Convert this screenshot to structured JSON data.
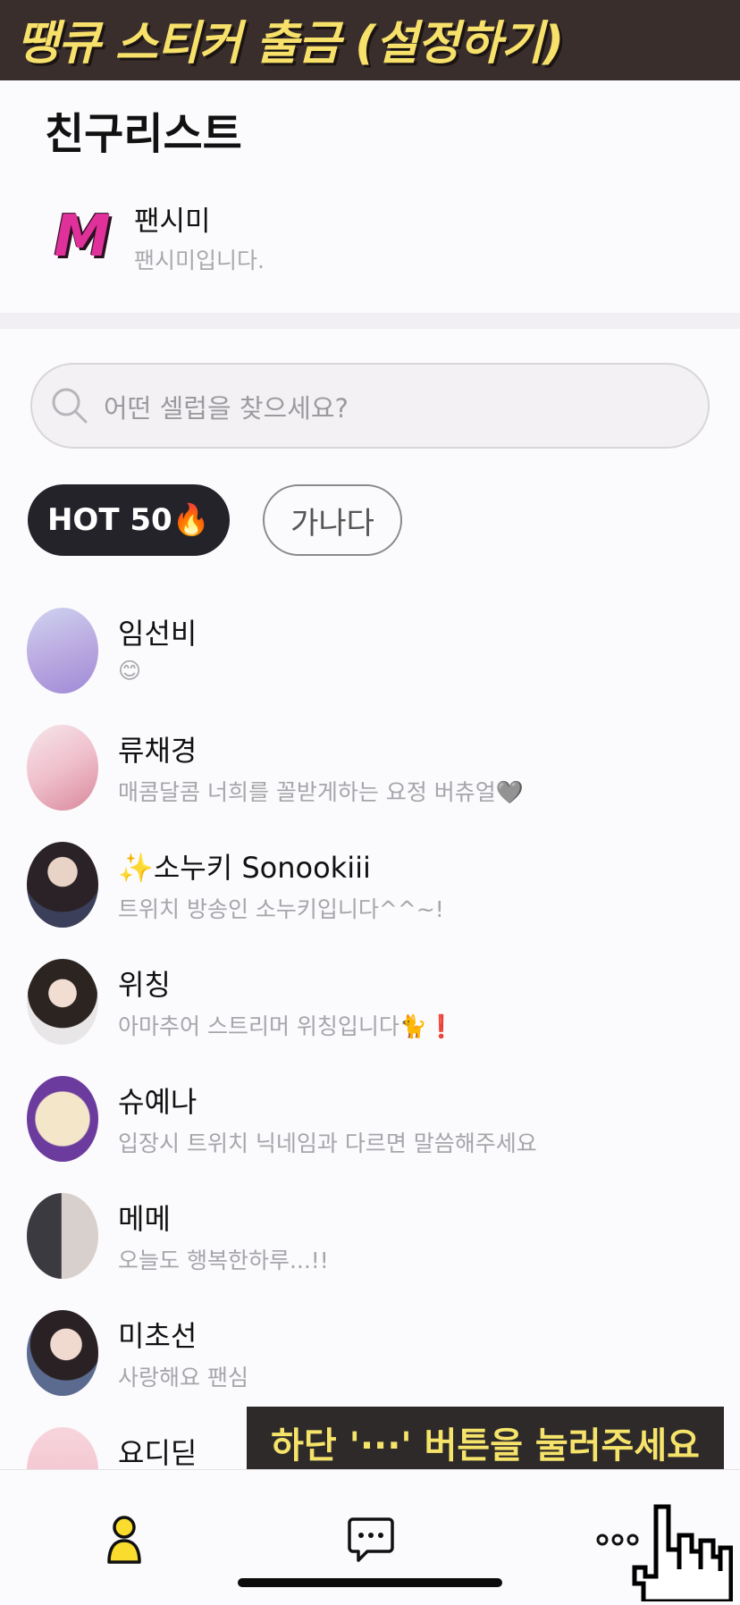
{
  "banner": {
    "title": "땡큐 스티커 출금 (설정하기)"
  },
  "friends_section": {
    "title": "친구리스트",
    "friend": {
      "logo_letter": "M",
      "name": "팬시미",
      "status": "팬시미입니다."
    }
  },
  "search": {
    "placeholder": "어떤 셀럽을 찾으세요?"
  },
  "chips": {
    "hot": "HOT 50🔥",
    "abc": "가나다"
  },
  "celebs": [
    {
      "name": "임선비",
      "status": "😊"
    },
    {
      "name": "류채경",
      "status": "매콤달콤 너희를 꼴받게하는 요정 버츄얼🩶"
    },
    {
      "name": "✨소누키 Sonookiii",
      "status": "트위치 방송인 소누키입니다^^~!"
    },
    {
      "name": "위칭",
      "status": "아마추어 스트리머 위칭입니다🐈❗"
    },
    {
      "name": "슈예나",
      "status": "입장시 트위치 닉네임과 다르면 말씀해주세요"
    },
    {
      "name": "메메",
      "status": "오늘도 행복한하루...!!"
    },
    {
      "name": "미초선",
      "status": "사랑해요 팬심"
    },
    {
      "name": "요디딛",
      "status": ""
    }
  ],
  "caption": {
    "text": "하단 '···' 버튼을 눌러주세요"
  },
  "tabs": {
    "friends": "person-icon",
    "chat": "chat-bubble-icon",
    "more": "more-icon"
  },
  "colors": {
    "accent": "#f7e16b",
    "banner_bg": "#3a2e2c",
    "chip_dark": "#25232a"
  }
}
